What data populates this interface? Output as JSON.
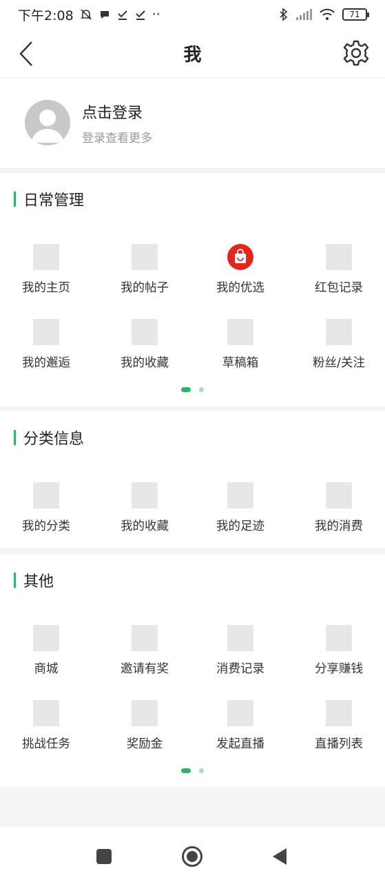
{
  "status_bar": {
    "time": "下午2:08",
    "dots": "··",
    "battery": "71"
  },
  "header": {
    "title": "我"
  },
  "profile": {
    "login_title": "点击登录",
    "login_subtitle": "登录查看更多"
  },
  "sections": [
    {
      "title": "日常管理",
      "items": [
        {
          "label": "我的主页",
          "icon": "placeholder-icon"
        },
        {
          "label": "我的帖子",
          "icon": "placeholder-icon"
        },
        {
          "label": "我的优选",
          "icon": "shopping-bag-icon"
        },
        {
          "label": "红包记录",
          "icon": "placeholder-icon"
        },
        {
          "label": "我的邂逅",
          "icon": "placeholder-icon"
        },
        {
          "label": "我的收藏",
          "icon": "placeholder-icon"
        },
        {
          "label": "草稿箱",
          "icon": "placeholder-icon"
        },
        {
          "label": "粉丝/关注",
          "icon": "placeholder-icon"
        }
      ],
      "page_indicator": {
        "pages": 2,
        "current": 1
      }
    },
    {
      "title": "分类信息",
      "items": [
        {
          "label": "我的分类",
          "icon": "placeholder-icon"
        },
        {
          "label": "我的收藏",
          "icon": "placeholder-icon"
        },
        {
          "label": "我的足迹",
          "icon": "placeholder-icon"
        },
        {
          "label": "我的消费",
          "icon": "placeholder-icon"
        }
      ]
    },
    {
      "title": "其他",
      "items": [
        {
          "label": "商城",
          "icon": "placeholder-icon"
        },
        {
          "label": "邀请有奖",
          "icon": "placeholder-icon"
        },
        {
          "label": "消费记录",
          "icon": "placeholder-icon"
        },
        {
          "label": "分享赚钱",
          "icon": "placeholder-icon"
        },
        {
          "label": "挑战任务",
          "icon": "placeholder-icon"
        },
        {
          "label": "奖励金",
          "icon": "placeholder-icon"
        },
        {
          "label": "发起直播",
          "icon": "placeholder-icon"
        },
        {
          "label": "直播列表",
          "icon": "placeholder-icon"
        }
      ],
      "page_indicator": {
        "pages": 2,
        "current": 1
      }
    }
  ],
  "colors": {
    "accent": "#2db36b",
    "accent_light": "#a8dcbf",
    "shop_red": "#e1261c",
    "placeholder": "#e8e6e6",
    "background": "#f5f5f5"
  }
}
